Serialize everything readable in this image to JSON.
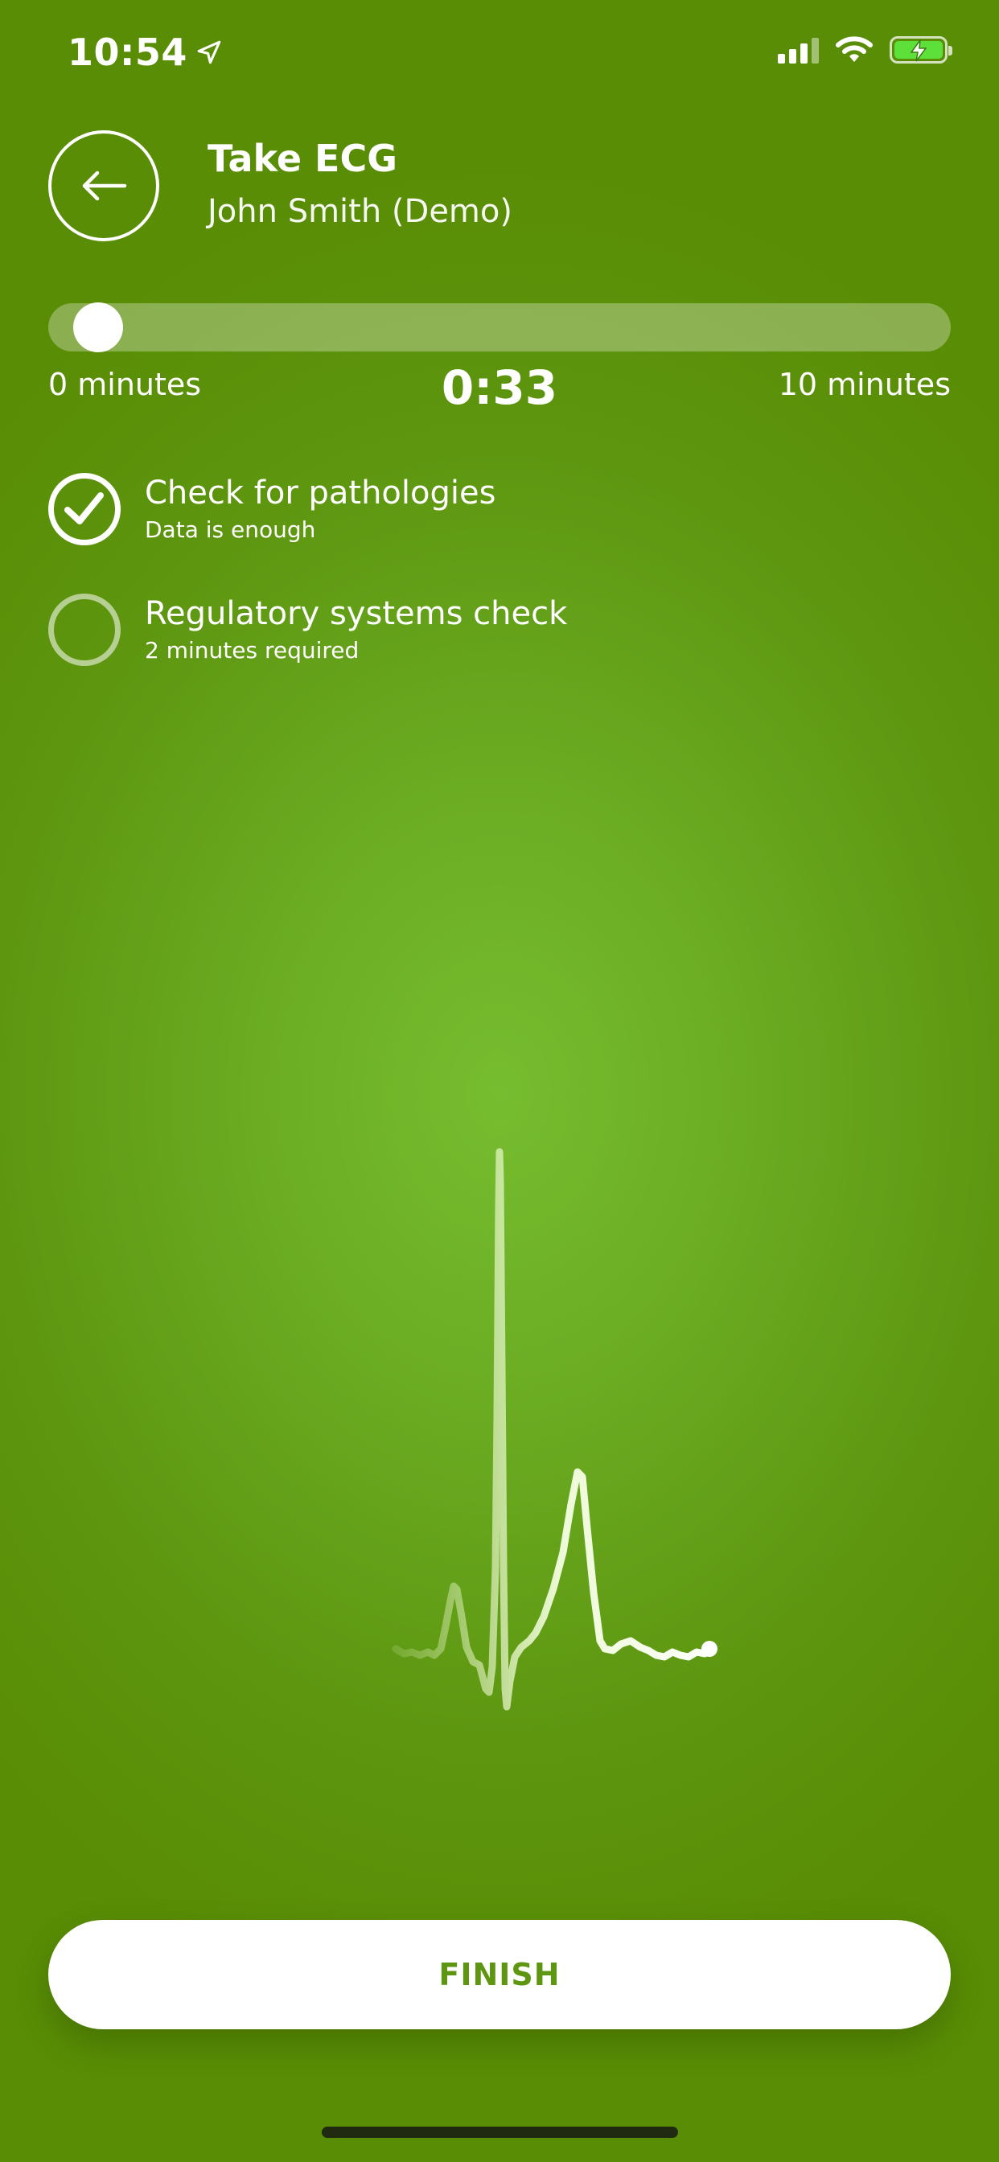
{
  "status_bar": {
    "time": "10:54",
    "location_icon": "location-arrow-icon",
    "signal_icon": "cellular-signal-icon",
    "wifi_icon": "wifi-icon",
    "battery_icon": "battery-charging-icon",
    "battery_color": "#5ee03a"
  },
  "header": {
    "back_icon": "arrow-left-icon",
    "title": "Take ECG",
    "subtitle": "John Smith (Demo)"
  },
  "progress": {
    "min_label": "0 minutes",
    "max_label": "10 minutes",
    "elapsed": "0:33",
    "fraction": 0.055
  },
  "checks": [
    {
      "title": "Check for pathologies",
      "subtitle": "Data is enough",
      "done": true,
      "icon": "checkmark-icon"
    },
    {
      "title": "Regulatory systems check",
      "subtitle": "2 minutes required",
      "done": false,
      "icon": "empty-circle-icon"
    }
  ],
  "finish_label": "FINISH",
  "colors": {
    "background": "#5e9610",
    "background_center": "#77bd30",
    "accent_text": "#5e9612",
    "ecg_trace": "#eefbd2"
  }
}
